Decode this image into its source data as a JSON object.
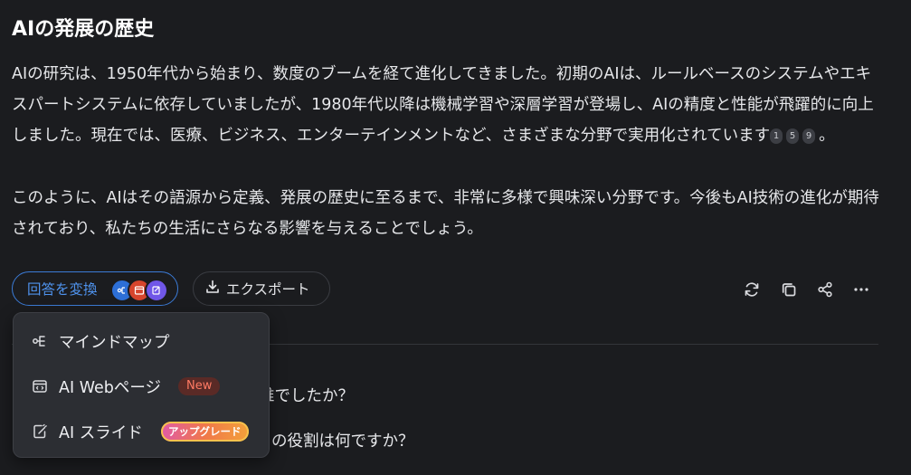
{
  "article": {
    "heading": "AIの発展の歴史",
    "paragraph1": "AIの研究は、1950年代から始まり、数度のブームを経て進化してきました。初期のAIは、ルールベースのシステムやエキスパートシステムに依存していましたが、1980年代以降は機械学習や深層学習が登場し、AIの精度と性能が飛躍的に向上しました。現在では、医療、ビジネス、エンターテインメントなど、さまざまな分野で実用化されています",
    "citations": [
      "1",
      "5",
      "9"
    ],
    "paragraph1_end": "。",
    "paragraph2": "このように、AIはその語源から定義、発展の歴史に至るまで、非常に多様で興味深い分野です。今後もAI技術の進化が期待されており、私たちの生活にさらなる影響を与えることでしょう。"
  },
  "toolbar": {
    "convert_label": "回答を変換",
    "export_label": "エクスポート",
    "actions": [
      "refresh-icon",
      "copy-icon",
      "share-icon",
      "more-icon"
    ]
  },
  "dropdown": {
    "items": [
      {
        "label": "マインドマップ",
        "icon": "mindmap-icon"
      },
      {
        "label": "AI Webページ",
        "icon": "webpage-icon",
        "badge": "New"
      },
      {
        "label": "AI スライド",
        "icon": "slides-icon",
        "badge": "アップグレード"
      }
    ]
  },
  "related_questions": {
    "q1_visible": "誰でしたか？",
    "q2_visible": "の役割は何ですか？"
  },
  "colors": {
    "accent": "#3b7bd6",
    "background": "#1b1c1f",
    "menu_bg": "#2c2e33",
    "new_badge": "#ff7a63"
  }
}
